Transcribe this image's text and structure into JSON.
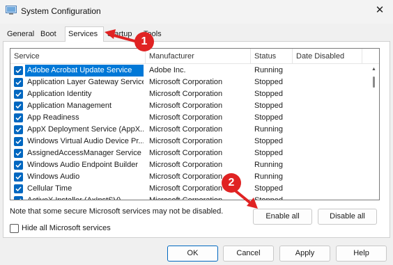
{
  "window": {
    "title": "System Configuration",
    "close_glyph": "✕"
  },
  "tabs": [
    "General",
    "Boot",
    "Services",
    "Startup",
    "Tools"
  ],
  "active_tab": "Services",
  "columns": [
    "Service",
    "Manufacturer",
    "Status",
    "Date Disabled"
  ],
  "services": [
    {
      "name": "Adobe Acrobat Update Service",
      "manufacturer": "Adobe Inc.",
      "status": "Running",
      "date_disabled": "",
      "checked": true
    },
    {
      "name": "Application Layer Gateway Service",
      "manufacturer": "Microsoft Corporation",
      "status": "Stopped",
      "date_disabled": "",
      "checked": true
    },
    {
      "name": "Application Identity",
      "manufacturer": "Microsoft Corporation",
      "status": "Stopped",
      "date_disabled": "",
      "checked": true
    },
    {
      "name": "Application Management",
      "manufacturer": "Microsoft Corporation",
      "status": "Stopped",
      "date_disabled": "",
      "checked": true
    },
    {
      "name": "App Readiness",
      "manufacturer": "Microsoft Corporation",
      "status": "Stopped",
      "date_disabled": "",
      "checked": true
    },
    {
      "name": "AppX Deployment Service (AppX...",
      "manufacturer": "Microsoft Corporation",
      "status": "Running",
      "date_disabled": "",
      "checked": true
    },
    {
      "name": "Windows Virtual Audio Device Pr...",
      "manufacturer": "Microsoft Corporation",
      "status": "Stopped",
      "date_disabled": "",
      "checked": true
    },
    {
      "name": "AssignedAccessManager Service",
      "manufacturer": "Microsoft Corporation",
      "status": "Stopped",
      "date_disabled": "",
      "checked": true
    },
    {
      "name": "Windows Audio Endpoint Builder",
      "manufacturer": "Microsoft Corporation",
      "status": "Running",
      "date_disabled": "",
      "checked": true
    },
    {
      "name": "Windows Audio",
      "manufacturer": "Microsoft Corporation",
      "status": "Running",
      "date_disabled": "",
      "checked": true
    },
    {
      "name": "Cellular Time",
      "manufacturer": "Microsoft Corporation",
      "status": "Stopped",
      "date_disabled": "",
      "checked": true
    },
    {
      "name": "ActiveX Installer (AxInstSV)",
      "manufacturer": "Microsoft Corporation",
      "status": "Stopped",
      "date_disabled": "",
      "checked": true
    }
  ],
  "selected_row": 0,
  "note": "Note that some secure Microsoft services may not be disabled.",
  "enable_all": "Enable all",
  "disable_all": "Disable all",
  "hide_ms_label": "Hide all Microsoft services",
  "hide_ms_checked": false,
  "buttons": {
    "ok": "OK",
    "cancel": "Cancel",
    "apply": "Apply",
    "help": "Help"
  },
  "annotations": [
    {
      "number": "1"
    },
    {
      "number": "2"
    }
  ],
  "colors": {
    "selection": "#0078d7",
    "checkbox": "#0067c0",
    "annotation": "#e02323"
  }
}
